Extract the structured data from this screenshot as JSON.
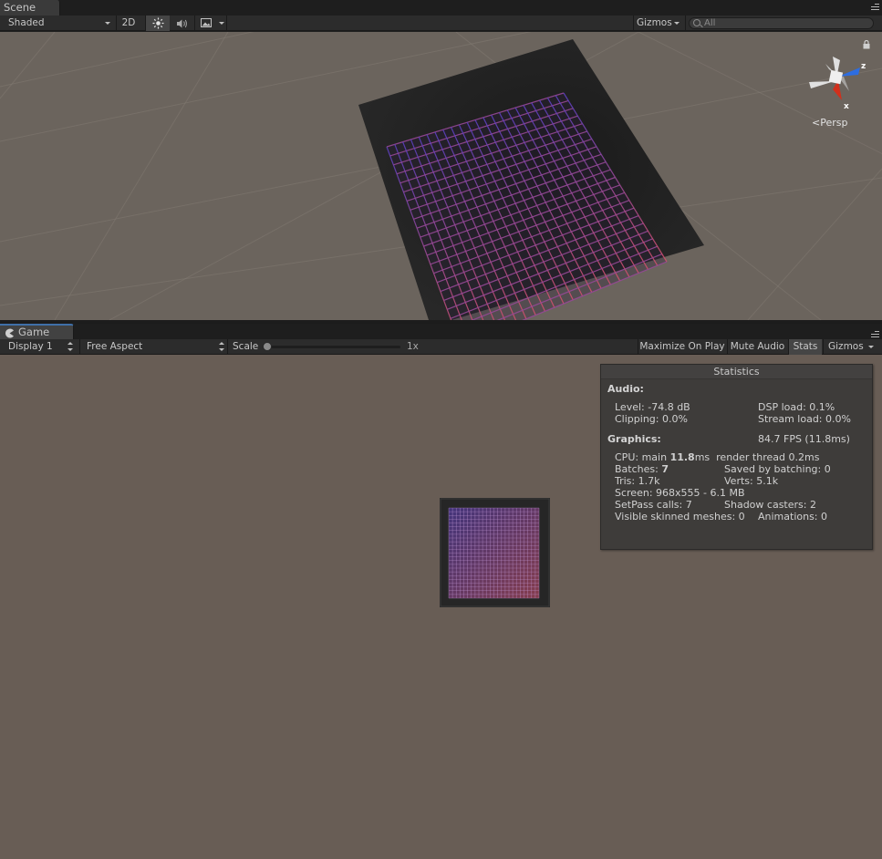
{
  "scene": {
    "tab_label": "Scene",
    "toolbar": {
      "shading_mode": "Shaded",
      "mode_2d": "2D",
      "gizmos_label": "Gizmos",
      "search_placeholder": "All"
    },
    "orientation_gizmo": {
      "projection_label": "Persp",
      "axis_z": "z",
      "axis_x": "x"
    }
  },
  "game": {
    "tab_label": "Game",
    "toolbar": {
      "display": "Display 1",
      "aspect": "Free Aspect",
      "scale_label": "Scale",
      "scale_value": "1x",
      "maximize_on_play": "Maximize On Play",
      "mute_audio": "Mute Audio",
      "stats": "Stats",
      "gizmos": "Gizmos"
    },
    "statistics": {
      "title": "Statistics",
      "audio_header": "Audio:",
      "level": "Level: -74.8 dB",
      "dsp_load": "DSP load: 0.1%",
      "clipping": "Clipping: 0.0%",
      "stream_load": "Stream load: 0.0%",
      "graphics_header": "Graphics:",
      "fps": "84.7 FPS (11.8ms)",
      "cpu_prefix": "CPU: main ",
      "cpu_main_value": "11.8",
      "cpu_suffix": "ms  render thread 0.2ms",
      "batches_prefix": "Batches: ",
      "batches_value": "7",
      "saved_by_batching": "Saved by batching: 0",
      "tris": "Tris: 1.7k",
      "verts": "Verts: 5.1k",
      "screen": "Screen: 968x555 - 6.1 MB",
      "setpass_calls": "SetPass calls: 7",
      "shadow_casters": "Shadow casters: 2",
      "visible_skinned_meshes": "Visible skinned meshes: 0",
      "animations": "Animations: 0"
    }
  },
  "colors": {
    "scene_background": "#6b645d",
    "game_background": "#685d55",
    "grid_start": "#5a3fc0",
    "grid_end": "#d2506c",
    "active_tab_accent": "#3f6fa8"
  }
}
